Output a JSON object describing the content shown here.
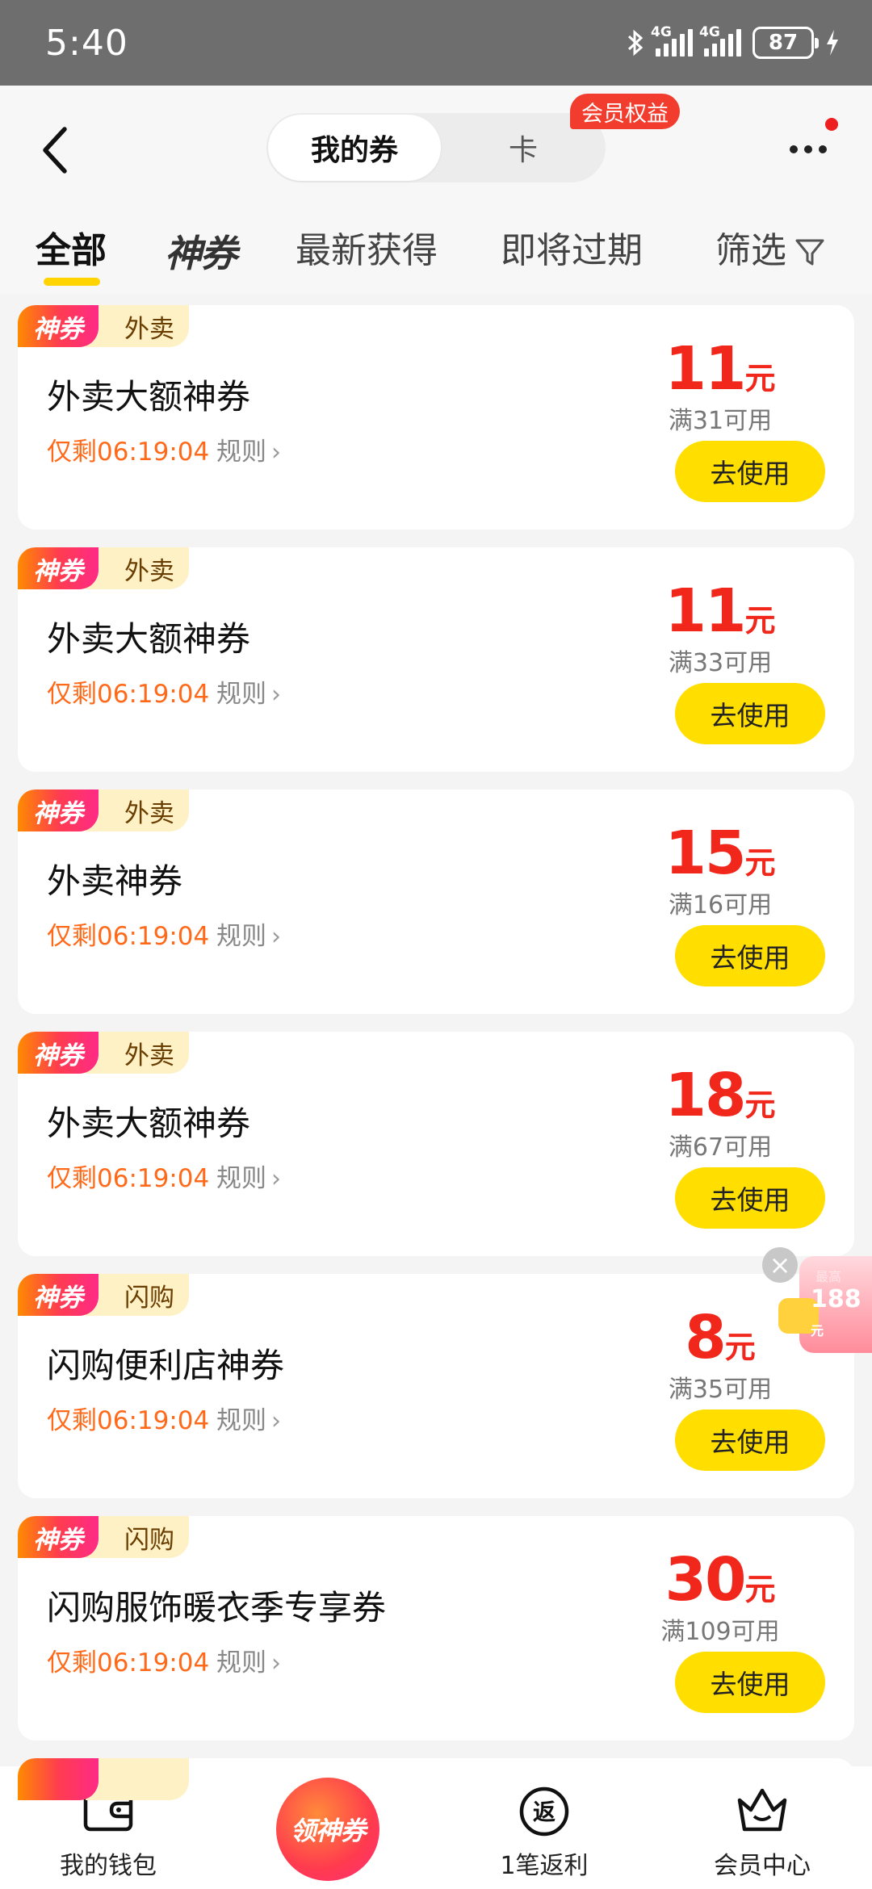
{
  "status_bar": {
    "time": "5:40",
    "network_1": "4G",
    "network_2": "4G",
    "battery": "87",
    "icons": [
      "bluetooth-icon",
      "signal-icon",
      "signal-icon",
      "battery-icon",
      "charging-icon"
    ]
  },
  "header": {
    "back_icon": "chevron-left-icon",
    "segment_active": "我的券",
    "segment_other": "卡",
    "member_badge": "会员权益",
    "more_icon": "more-dots-icon"
  },
  "filter_tabs": {
    "all": "全部",
    "shenquan": "神券",
    "latest": "最新获得",
    "expiring": "即将过期",
    "filter": "筛选",
    "filter_icon": "funnel-icon"
  },
  "coupons": [
    {
      "tag": "神券",
      "category": "外卖",
      "title": "外卖大额神券",
      "remaining": "仅剩06:19:04",
      "rule": "规则",
      "amount": "11",
      "unit": "元",
      "condition": "满31可用",
      "action": "去使用"
    },
    {
      "tag": "神券",
      "category": "外卖",
      "title": "外卖大额神券",
      "remaining": "仅剩06:19:04",
      "rule": "规则",
      "amount": "11",
      "unit": "元",
      "condition": "满33可用",
      "action": "去使用"
    },
    {
      "tag": "神券",
      "category": "外卖",
      "title": "外卖神券",
      "remaining": "仅剩06:19:04",
      "rule": "规则",
      "amount": "15",
      "unit": "元",
      "condition": "满16可用",
      "action": "去使用"
    },
    {
      "tag": "神券",
      "category": "外卖",
      "title": "外卖大额神券",
      "remaining": "仅剩06:19:04",
      "rule": "规则",
      "amount": "18",
      "unit": "元",
      "condition": "满67可用",
      "action": "去使用"
    },
    {
      "tag": "神券",
      "category": "闪购",
      "title": "闪购便利店神券",
      "remaining": "仅剩06:19:04",
      "rule": "规则",
      "amount": "8",
      "unit": "元",
      "condition": "满35可用",
      "action": "去使用"
    },
    {
      "tag": "神券",
      "category": "闪购",
      "title": "闪购服饰暖衣季专享券",
      "remaining": "仅剩06:19:04",
      "rule": "规则",
      "amount": "30",
      "unit": "元",
      "condition": "满109可用",
      "action": "去使用"
    }
  ],
  "floating_promo": {
    "label": "最高",
    "amount": "188",
    "unit": "元",
    "close_icon": "close-icon"
  },
  "bottom_nav": {
    "wallet": "我的钱包",
    "wallet_icon": "wallet-icon",
    "center": "领神券",
    "rebate": "1笔返利",
    "rebate_icon_text": "返",
    "member": "会员中心",
    "member_icon": "crown-icon"
  },
  "colors": {
    "accent_yellow": "#ffde00",
    "price_red": "#f2271c",
    "countdown_orange": "#ff6a1a",
    "badge_red": "#f23c2d"
  }
}
